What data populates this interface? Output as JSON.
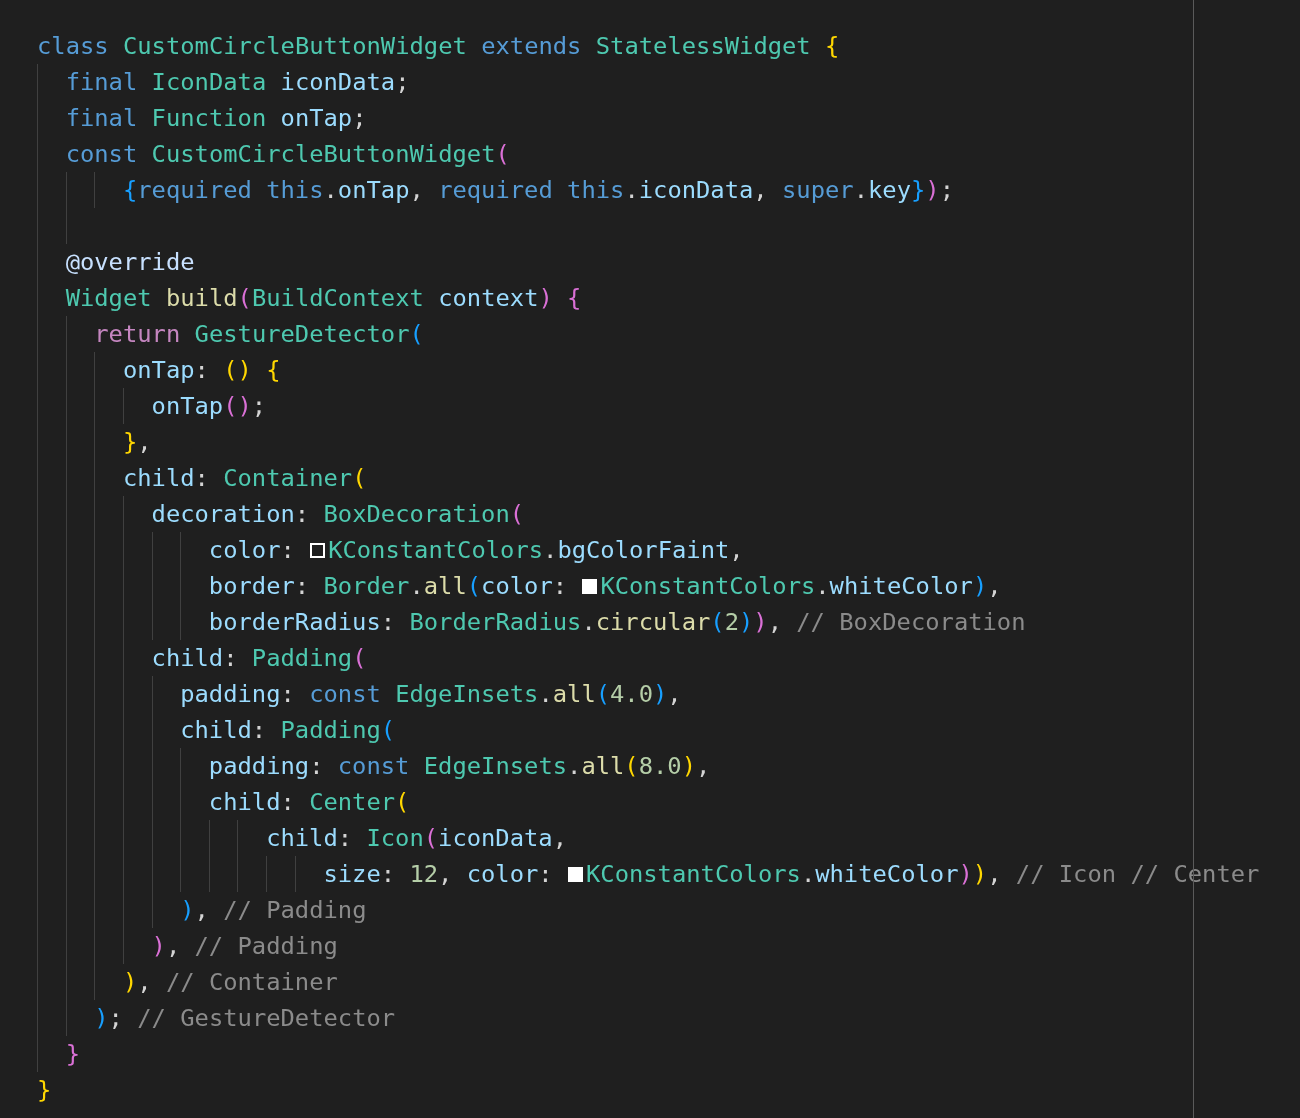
{
  "editor": {
    "lines": [
      {
        "tokens": [
          {
            "kind": "kw",
            "text": "class "
          },
          {
            "kind": "type",
            "text": "CustomCircleButtonWidget "
          },
          {
            "kind": "kw",
            "text": "extends "
          },
          {
            "kind": "type",
            "text": "StatelessWidget "
          },
          {
            "kind": "b1",
            "text": "{"
          }
        ]
      },
      {
        "tokens": [
          {
            "kind": "kw",
            "text": "  final "
          },
          {
            "kind": "type",
            "text": "IconData "
          },
          {
            "kind": "var",
            "text": "iconData"
          },
          {
            "kind": "p",
            "text": ";"
          }
        ]
      },
      {
        "tokens": [
          {
            "kind": "kw",
            "text": "  final "
          },
          {
            "kind": "type",
            "text": "Function "
          },
          {
            "kind": "var",
            "text": "onTap"
          },
          {
            "kind": "p",
            "text": ";"
          }
        ]
      },
      {
        "tokens": [
          {
            "kind": "kw",
            "text": "  const "
          },
          {
            "kind": "type",
            "text": "CustomCircleButtonWidget"
          },
          {
            "kind": "b2",
            "text": "("
          }
        ]
      },
      {
        "tokens": [
          {
            "kind": "b3",
            "text": "      {"
          },
          {
            "kind": "kw",
            "text": "required this"
          },
          {
            "kind": "p",
            "text": "."
          },
          {
            "kind": "var",
            "text": "onTap"
          },
          {
            "kind": "p",
            "text": ", "
          },
          {
            "kind": "kw",
            "text": "required this"
          },
          {
            "kind": "p",
            "text": "."
          },
          {
            "kind": "var",
            "text": "iconData"
          },
          {
            "kind": "p",
            "text": ", "
          },
          {
            "kind": "kw",
            "text": "super"
          },
          {
            "kind": "p",
            "text": "."
          },
          {
            "kind": "var",
            "text": "key"
          },
          {
            "kind": "b3",
            "text": "}"
          },
          {
            "kind": "b2",
            "text": ")"
          },
          {
            "kind": "p",
            "text": ";"
          }
        ]
      },
      {
        "kind": "blank"
      },
      {
        "tokens": [
          {
            "kind": "anno",
            "text": "  @override"
          }
        ]
      },
      {
        "tokens": [
          {
            "kind": "type",
            "text": "  Widget "
          },
          {
            "kind": "fn",
            "text": "build"
          },
          {
            "kind": "b2",
            "text": "("
          },
          {
            "kind": "type",
            "text": "BuildContext "
          },
          {
            "kind": "var",
            "text": "context"
          },
          {
            "kind": "b2",
            "text": ") {"
          }
        ]
      },
      {
        "tokens": [
          {
            "kind": "ctrl",
            "text": "    return "
          },
          {
            "kind": "type",
            "text": "GestureDetector"
          },
          {
            "kind": "b3",
            "text": "("
          }
        ]
      },
      {
        "tokens": [
          {
            "kind": "var",
            "text": "      onTap"
          },
          {
            "kind": "p",
            "text": ": "
          },
          {
            "kind": "b1",
            "text": "() {"
          }
        ]
      },
      {
        "tokens": [
          {
            "kind": "var",
            "text": "        onTap"
          },
          {
            "kind": "b2",
            "text": "()"
          },
          {
            "kind": "p",
            "text": ";"
          }
        ]
      },
      {
        "tokens": [
          {
            "kind": "b1",
            "text": "      }"
          },
          {
            "kind": "p",
            "text": ","
          }
        ]
      },
      {
        "tokens": [
          {
            "kind": "var",
            "text": "      child"
          },
          {
            "kind": "p",
            "text": ": "
          },
          {
            "kind": "type",
            "text": "Container"
          },
          {
            "kind": "b1",
            "text": "("
          }
        ]
      },
      {
        "tokens": [
          {
            "kind": "var",
            "text": "        decoration"
          },
          {
            "kind": "p",
            "text": ": "
          },
          {
            "kind": "type",
            "text": "BoxDecoration"
          },
          {
            "kind": "b2",
            "text": "("
          }
        ]
      },
      {
        "tokens": [
          {
            "kind": "var",
            "text": "            color"
          },
          {
            "kind": "p",
            "text": ": "
          },
          {
            "kind": "swatch",
            "color": "#1e1e1e"
          },
          {
            "kind": "type",
            "text": "KConstantColors"
          },
          {
            "kind": "p",
            "text": "."
          },
          {
            "kind": "var",
            "text": "bgColorFaint"
          },
          {
            "kind": "p",
            "text": ","
          }
        ]
      },
      {
        "tokens": [
          {
            "kind": "var",
            "text": "            border"
          },
          {
            "kind": "p",
            "text": ": "
          },
          {
            "kind": "type",
            "text": "Border"
          },
          {
            "kind": "p",
            "text": "."
          },
          {
            "kind": "fn",
            "text": "all"
          },
          {
            "kind": "b3",
            "text": "("
          },
          {
            "kind": "var",
            "text": "color"
          },
          {
            "kind": "p",
            "text": ": "
          },
          {
            "kind": "swatch",
            "color": "#ffffff"
          },
          {
            "kind": "type",
            "text": "KConstantColors"
          },
          {
            "kind": "p",
            "text": "."
          },
          {
            "kind": "var",
            "text": "whiteColor"
          },
          {
            "kind": "b3",
            "text": ")"
          },
          {
            "kind": "p",
            "text": ","
          }
        ]
      },
      {
        "tokens": [
          {
            "kind": "var",
            "text": "            borderRadius"
          },
          {
            "kind": "p",
            "text": ": "
          },
          {
            "kind": "type",
            "text": "BorderRadius"
          },
          {
            "kind": "p",
            "text": "."
          },
          {
            "kind": "fn",
            "text": "circular"
          },
          {
            "kind": "b3",
            "text": "("
          },
          {
            "kind": "num",
            "text": "2"
          },
          {
            "kind": "b3",
            "text": ")"
          },
          {
            "kind": "b2",
            "text": ")"
          },
          {
            "kind": "p",
            "text": ", "
          },
          {
            "kind": "comment",
            "text": "// BoxDecoration"
          }
        ]
      },
      {
        "tokens": [
          {
            "kind": "var",
            "text": "        child"
          },
          {
            "kind": "p",
            "text": ": "
          },
          {
            "kind": "type",
            "text": "Padding"
          },
          {
            "kind": "b2",
            "text": "("
          }
        ]
      },
      {
        "tokens": [
          {
            "kind": "var",
            "text": "          padding"
          },
          {
            "kind": "p",
            "text": ": "
          },
          {
            "kind": "kw",
            "text": "const "
          },
          {
            "kind": "type",
            "text": "EdgeInsets"
          },
          {
            "kind": "p",
            "text": "."
          },
          {
            "kind": "fn",
            "text": "all"
          },
          {
            "kind": "b3",
            "text": "("
          },
          {
            "kind": "num",
            "text": "4.0"
          },
          {
            "kind": "b3",
            "text": ")"
          },
          {
            "kind": "p",
            "text": ","
          }
        ]
      },
      {
        "tokens": [
          {
            "kind": "var",
            "text": "          child"
          },
          {
            "kind": "p",
            "text": ": "
          },
          {
            "kind": "type",
            "text": "Padding"
          },
          {
            "kind": "b3",
            "text": "("
          }
        ]
      },
      {
        "tokens": [
          {
            "kind": "var",
            "text": "            padding"
          },
          {
            "kind": "p",
            "text": ": "
          },
          {
            "kind": "kw",
            "text": "const "
          },
          {
            "kind": "type",
            "text": "EdgeInsets"
          },
          {
            "kind": "p",
            "text": "."
          },
          {
            "kind": "fn",
            "text": "all"
          },
          {
            "kind": "b1",
            "text": "("
          },
          {
            "kind": "num",
            "text": "8.0"
          },
          {
            "kind": "b1",
            "text": ")"
          },
          {
            "kind": "p",
            "text": ","
          }
        ]
      },
      {
        "tokens": [
          {
            "kind": "var",
            "text": "            child"
          },
          {
            "kind": "p",
            "text": ": "
          },
          {
            "kind": "type",
            "text": "Center"
          },
          {
            "kind": "b1",
            "text": "("
          }
        ]
      },
      {
        "tokens": [
          {
            "kind": "var",
            "text": "                child"
          },
          {
            "kind": "p",
            "text": ": "
          },
          {
            "kind": "type",
            "text": "Icon"
          },
          {
            "kind": "b2",
            "text": "("
          },
          {
            "kind": "var",
            "text": "iconData"
          },
          {
            "kind": "p",
            "text": ","
          }
        ]
      },
      {
        "tokens": [
          {
            "kind": "var",
            "text": "                    size"
          },
          {
            "kind": "p",
            "text": ": "
          },
          {
            "kind": "num",
            "text": "12"
          },
          {
            "kind": "p",
            "text": ", "
          },
          {
            "kind": "var",
            "text": "color"
          },
          {
            "kind": "p",
            "text": ": "
          },
          {
            "kind": "swatch",
            "color": "#ffffff"
          },
          {
            "kind": "type",
            "text": "KConstantColors"
          },
          {
            "kind": "p",
            "text": "."
          },
          {
            "kind": "var",
            "text": "whiteColor"
          },
          {
            "kind": "b2",
            "text": ")"
          },
          {
            "kind": "b1",
            "text": ")"
          },
          {
            "kind": "p",
            "text": ", "
          },
          {
            "kind": "comment",
            "text": "// Icon // Center"
          }
        ]
      },
      {
        "tokens": [
          {
            "kind": "b3",
            "text": "          )"
          },
          {
            "kind": "p",
            "text": ", "
          },
          {
            "kind": "comment",
            "text": "// Padding"
          }
        ]
      },
      {
        "tokens": [
          {
            "kind": "b2",
            "text": "        )"
          },
          {
            "kind": "p",
            "text": ", "
          },
          {
            "kind": "comment",
            "text": "// Padding"
          }
        ]
      },
      {
        "tokens": [
          {
            "kind": "b1",
            "text": "      )"
          },
          {
            "kind": "p",
            "text": ", "
          },
          {
            "kind": "comment",
            "text": "// Container"
          }
        ]
      },
      {
        "tokens": [
          {
            "kind": "b3",
            "text": "    )"
          },
          {
            "kind": "p",
            "text": "; "
          },
          {
            "kind": "comment",
            "text": "// GestureDetector"
          }
        ]
      },
      {
        "tokens": [
          {
            "kind": "b2",
            "text": "  }"
          }
        ]
      },
      {
        "tokens": [
          {
            "kind": "b1",
            "text": "}"
          }
        ]
      }
    ]
  }
}
